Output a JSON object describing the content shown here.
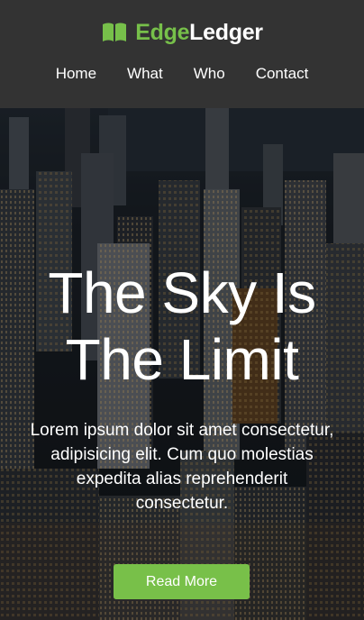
{
  "brand": {
    "accent_part": "Edge",
    "rest_part": "Ledger",
    "icon": "open-book-icon",
    "accent_color": "#77c04a"
  },
  "nav": {
    "items": [
      {
        "label": "Home"
      },
      {
        "label": "What"
      },
      {
        "label": "Who"
      },
      {
        "label": "Contact"
      }
    ]
  },
  "hero": {
    "title_line1": "The Sky Is",
    "title_line2": "The Limit",
    "text": "Lorem ipsum dolor sit amet consectetur, adipisicing elit. Cum quo molestias expedita alias reprehenderit consectetur.",
    "button_label": "Read More",
    "button_color": "#78c049",
    "background": "night-city-skyline-image"
  }
}
